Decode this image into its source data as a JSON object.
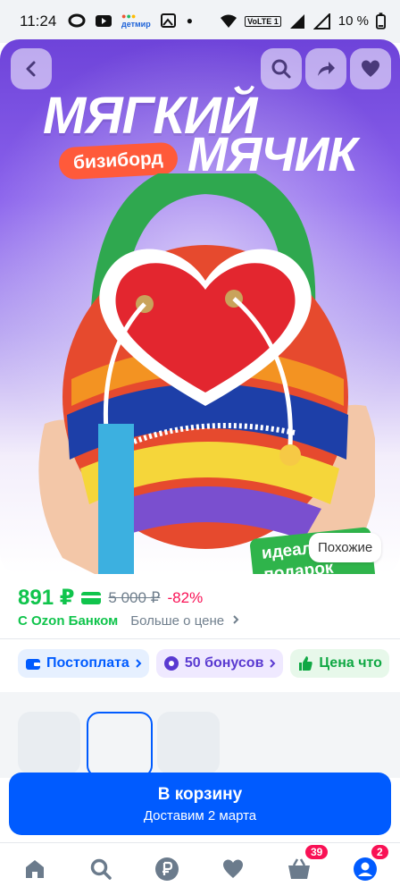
{
  "status_bar": {
    "time": "11:24",
    "app_logo": "детмир",
    "network": "VoLTE 1",
    "battery": "10 %"
  },
  "hero": {
    "title_line1": "МЯГКИЙ",
    "title_line2": "МЯЧИК",
    "tag": "бизиборд",
    "promo": "идеальный подарок",
    "similar_button": "Похожие"
  },
  "price": {
    "current": "891 ₽",
    "old": "5 000 ₽",
    "discount": "-82%",
    "bank_label": "С Ozon Банком",
    "more_label": "Больше о цене"
  },
  "chips": [
    {
      "label": "Постоплата"
    },
    {
      "label": "50 бонусов"
    },
    {
      "label": "Цена что"
    }
  ],
  "cart": {
    "button_label": "В корзину",
    "delivery": "Доставим 2 марта"
  },
  "tabbar": {
    "cart_count": "39",
    "profile_count": "2"
  },
  "colors": {
    "accent": "#005bff",
    "price_green": "#10c44c",
    "discount_red": "#f91155"
  }
}
